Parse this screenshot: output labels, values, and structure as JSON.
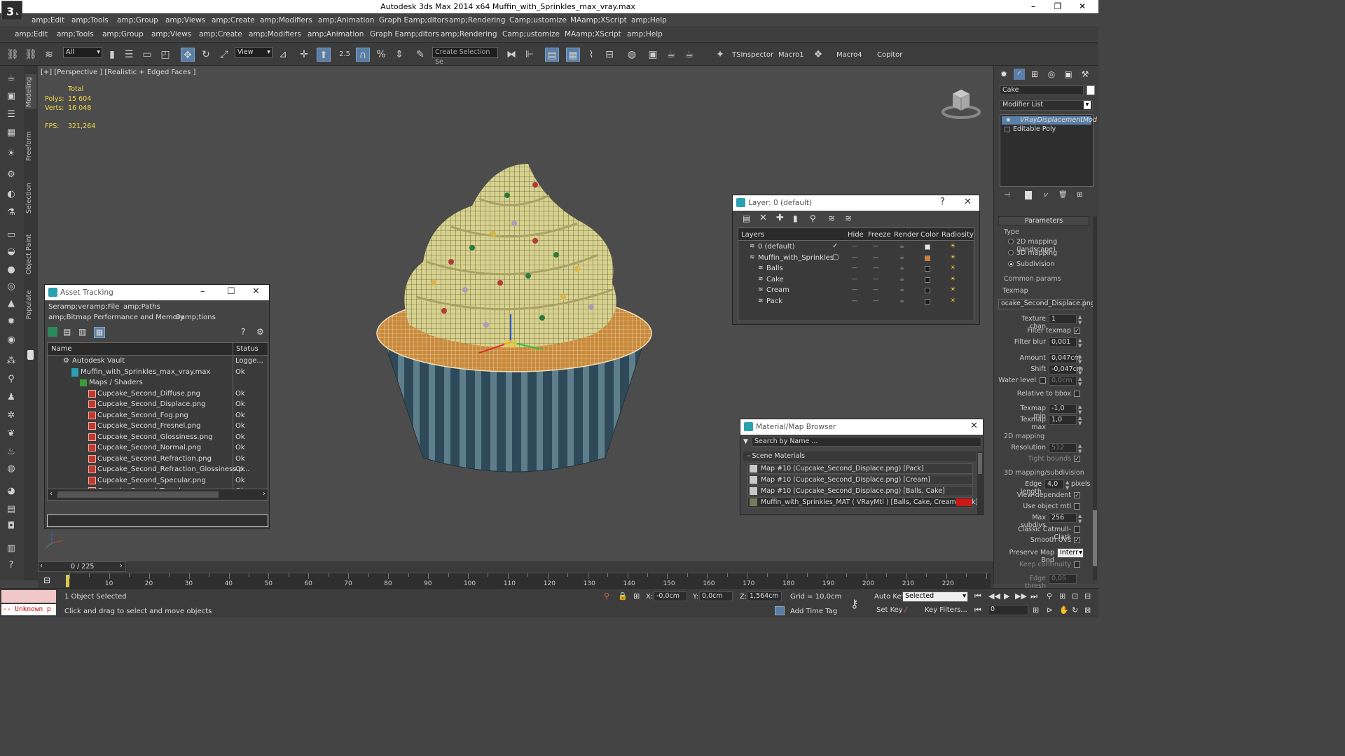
{
  "app": {
    "title": "Autodesk 3ds Max  2014 x64     Muffin_with_Sprinkles_max_vray.max",
    "window_controls": [
      "–",
      "❐",
      "✕"
    ]
  },
  "menu1": [
    "amp;Edit",
    "amp;Tools",
    "amp;Group",
    "amp;Views",
    "amp;Create",
    "amp;Modifiers",
    "amp;Animation",
    "Graph Eamp;ditors",
    "amp;Rendering",
    "Camp;ustomize",
    "MAamp;XScript",
    "amp;Help"
  ],
  "menu2": [
    "amp;Edit",
    "amp;Tools",
    "amp;Group",
    "amp;Views",
    "amp;Create",
    "amp;Modifiers",
    "amp;Animation",
    "Graph Eamp;ditors",
    "amp;Rendering",
    "Camp;ustomize",
    "MAamp;XScript",
    "amp;Help"
  ],
  "toolbar": {
    "selection_filter": "All",
    "ref_coord": "View",
    "snap_label": "2.5",
    "named_selection": "Create Selection Se",
    "macros": [
      "TSInspector",
      "Macro1",
      "Macro4",
      "Copitor"
    ]
  },
  "ribbon_tabs": [
    "Modeling",
    "Freeform",
    "Selection",
    "Object Paint",
    "Populate"
  ],
  "viewport": {
    "label": "[+] [Perspective ] [Realistic + Edged Faces ]",
    "stats": {
      "total_label": "Total",
      "polys_label": "Polys:",
      "polys": "15 604",
      "verts_label": "Verts:",
      "verts": "16 048",
      "fps_label": "FPS:",
      "fps": "321,264"
    }
  },
  "asset_tracking": {
    "title": "Asset Tracking",
    "menu": [
      "Seramp;ver",
      "amp;File",
      "amp;Paths"
    ],
    "menu2": [
      "amp;Bitmap Performance and Memory",
      "Oamp;tions"
    ],
    "col_name": "Name",
    "col_status": "Status",
    "rows": [
      {
        "name": "Autodesk Vault",
        "status": "Logge...",
        "indent": 1
      },
      {
        "name": "Muffin_with_Sprinkles_max_vray.max",
        "status": "Ok",
        "indent": 2
      },
      {
        "name": "Maps / Shaders",
        "status": "",
        "indent": 3
      },
      {
        "name": "Cupcake_Second_Diffuse.png",
        "status": "Ok",
        "indent": 4
      },
      {
        "name": "Cupcake_Second_Displace.png",
        "status": "Ok",
        "indent": 4
      },
      {
        "name": "Cupcake_Second_Fog.png",
        "status": "Ok",
        "indent": 4
      },
      {
        "name": "Cupcake_Second_Fresnel.png",
        "status": "Ok",
        "indent": 4
      },
      {
        "name": "Cupcake_Second_Glossiness.png",
        "status": "Ok",
        "indent": 4
      },
      {
        "name": "Cupcake_Second_Normal.png",
        "status": "Ok",
        "indent": 4
      },
      {
        "name": "Cupcake_Second_Refraction.png",
        "status": "Ok",
        "indent": 4
      },
      {
        "name": "Cupcake_Second_Refraction_Glossiness.p...",
        "status": "Ok",
        "indent": 4
      },
      {
        "name": "Cupcake_Second_Specular.png",
        "status": "Ok",
        "indent": 4
      },
      {
        "name": "Cupcake_Second_Translucency.png",
        "status": "Ok",
        "indent": 4
      }
    ]
  },
  "layer_window": {
    "title": "Layer: 0 (default)",
    "help": "?",
    "cols": [
      "Layers",
      "Hide",
      "Freeze",
      "Render",
      "Color",
      "Radiosity"
    ],
    "rows": [
      {
        "name": "0 (default)",
        "indent": 1,
        "color": "#e8e8e8",
        "active": true
      },
      {
        "name": "Muffin_with_Sprinkles",
        "indent": 1,
        "color": "#e07a28",
        "active": false
      },
      {
        "name": "Balls",
        "indent": 2,
        "color": "#1a1a1a",
        "active": false
      },
      {
        "name": "Cake",
        "indent": 2,
        "color": "#1a1a1a",
        "active": false
      },
      {
        "name": "Cream",
        "indent": 2,
        "color": "#1a1a1a",
        "active": false
      },
      {
        "name": "Pack",
        "indent": 2,
        "color": "#1a1a1a",
        "active": false
      }
    ]
  },
  "material_browser": {
    "title": "Material/Map Browser",
    "search_placeholder": "Search by Name ...",
    "section": "- Scene Materials",
    "items": [
      {
        "label": "Map #10 (Cupcake_Second_Displace.png)  [Pack]",
        "selected": false
      },
      {
        "label": "Map #10 (Cupcake_Second_Displace.png)  [Cream]",
        "selected": false
      },
      {
        "label": "Map #10 (Cupcake_Second_Displace.png)  [Balls, Cake]",
        "selected": false
      },
      {
        "label": "Muffin_with_Sprinkles_MAT  ( VRayMtl )  [Balls, Cake, Cream, Pack]",
        "selected": true
      }
    ]
  },
  "command_panel": {
    "object_name": "Cake",
    "modifier_list": "Modifier List",
    "stack": [
      "VRayDisplacementMod",
      "Editable Poly"
    ],
    "parameters_header": "Parameters",
    "type_group": "Type",
    "type_options": [
      "2D mapping (landscape)",
      "3D mapping",
      "Subdivision"
    ],
    "type_selected": 2,
    "common_group": "Common params",
    "texmap_label": "Texmap",
    "texmap_value": "ocake_Second_Displace.png)",
    "texture_chan_label": "Texture chan",
    "texture_chan": "1",
    "filter_texmap_label": "Filter texmap",
    "filter_blur_label": "Filter blur",
    "filter_blur": "0,001",
    "amount_label": "Amount",
    "amount": "0,047cm",
    "shift_label": "Shift",
    "shift": "-0,047cm",
    "water_level_label": "Water level",
    "water_level": "0,0cm",
    "relative_bbox_label": "Relative to bbox",
    "texmap_min_label": "Texmap min",
    "texmap_min": "-1,0",
    "texmap_max_label": "Texmap max",
    "texmap_max": "1,0",
    "mapping2d_group": "2D mapping",
    "resolution_label": "Resolution",
    "resolution": "512",
    "tight_bounds_label": "Tight bounds",
    "subdiv_group": "3D mapping/subdivision",
    "edge_length_label": "Edge length",
    "edge_length": "4,0",
    "pixels_label": "pixels",
    "view_dependent_label": "View-dependent",
    "use_object_mtl_label": "Use object mtl",
    "max_subdivs_label": "Max subdivs",
    "max_subdivs": "256",
    "catmull_label": "Classic Catmull-Clark",
    "smooth_uvs_label": "Smooth UVs",
    "preserve_map_label": "Preserve Map Bnd",
    "preserve_map": "Interr",
    "keep_continuity_label": "Keep continuity",
    "edge_thresh_label": "Edge thresh",
    "edge_thresh": "0,05"
  },
  "timeline": {
    "frame_counter": "0 / 225",
    "ticks": [
      "10",
      "20",
      "30",
      "40",
      "50",
      "60",
      "70",
      "80",
      "90",
      "100",
      "110",
      "120",
      "130",
      "140",
      "150",
      "160",
      "170",
      "180",
      "190",
      "200",
      "210",
      "220"
    ]
  },
  "status": {
    "maxscript": "-- Unknown p",
    "selected": "1 Object Selected",
    "prompt": "Click and drag to select and move objects",
    "x_label": "X:",
    "x": "-0,0cm",
    "y_label": "Y:",
    "y": "0,0cm",
    "z_label": "Z:",
    "z": "1,564cm",
    "grid": "Grid = 10,0cm",
    "add_time_tag": "Add Time Tag",
    "auto_key": "Auto Key",
    "set_key": "Set Key",
    "key_mode": "Selected",
    "key_filters": "Key Filters...",
    "frame": "0"
  }
}
